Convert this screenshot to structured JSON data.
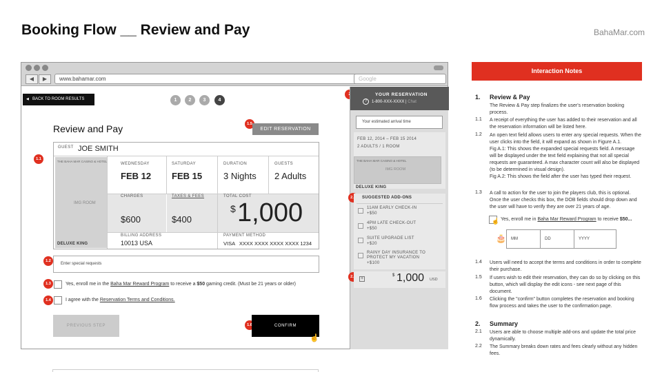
{
  "header": {
    "title": "Booking Flow  __  Review and Pay",
    "brand": "BahaMar.com"
  },
  "browser": {
    "url": "www.bahamar.com",
    "search_placeholder": "Google",
    "nav_back": "◀",
    "nav_forward": "▶"
  },
  "nav": {
    "back_label": "BACK TO ROOM RESULTS",
    "steps": [
      "1",
      "2",
      "3",
      "4"
    ],
    "active_step": 4
  },
  "review": {
    "title": "Review and Pay",
    "edit_label": "EDIT RESERVATION",
    "guest_label": "GUEST",
    "guest_name": "JOE SMITH",
    "hotel_name": "THE BAHA MAR CASINO & HOTEL",
    "img_label": "IMG ROOM",
    "room_type": "DELUXE KING",
    "checkin_label": "WEDNESDAY",
    "checkin_value": "FEB 12",
    "checkout_label": "SATURDAY",
    "checkout_value": "FEB 15",
    "duration_label": "DURATION",
    "duration_value": "3 Nights",
    "guests_label": "GUESTS",
    "guests_value": "2 Adults",
    "charges_label": "CHARGES",
    "charges_value": "$600",
    "taxes_label": "TAXES & FEES",
    "taxes_value": "$400",
    "total_label": "TOTAL COST",
    "total_currency": "$",
    "total_value": "1,000",
    "billing_label": "BILLING ADDRESS",
    "billing_value": "10013 USA",
    "payment_label": "PAYMENT METHOD",
    "payment_value": "VISA   XXXX XXXX XXXX XXXX 1234",
    "special_placeholder": "Enter special requests",
    "enroll_pre": "Yes, enroll me in the ",
    "enroll_link": "Baha Mar Reward Program",
    "enroll_mid": " to receive a ",
    "enroll_amt": "$50",
    "enroll_post": " gaming credit. (Must be 21 years or older)",
    "agree_pre": "I agree with the ",
    "agree_link": "Reservation Terms and Conditions.",
    "prev_label": "PREVIOUS STEP",
    "confirm_label": "CONFIRM"
  },
  "badges": [
    "1.1",
    "1.2",
    "1.3",
    "1.4",
    "1.5",
    "1.6",
    "2",
    "2.1",
    "2.2"
  ],
  "reservation": {
    "title": "YOUR RESERVATION",
    "phone_icon": "?",
    "phone": "1-800-XXX-XXXX",
    "sep": "|",
    "chat": "Chat",
    "arrival_placeholder": "Your estimated arrival time",
    "dates": "FEB 12, 2014 – FEB 15 2014",
    "party": "2 ADULTS / 1 ROOM",
    "hotel_name": "THE BAHA MAR CASINO & HOTEL",
    "img_label": "IMG ROOM",
    "room_type": "DELUXE KING",
    "addons_title": "SUGGESTED ADD-ONS",
    "addons": [
      {
        "name": "11AM EARLY CHECK-IN",
        "price": "+$50"
      },
      {
        "name": "4PM LATE CHECK-OUT",
        "price": "+$50"
      },
      {
        "name": "SUITE UPGRADE LIST",
        "price": "+$20"
      },
      {
        "name": "RAINY DAY INSURANCE TO",
        "name2": "PROTECT MY VACATION",
        "price": "+$100"
      }
    ],
    "plus": "+",
    "total_currency": "$",
    "total_value": "1,000",
    "total_unit": "USD"
  },
  "notes": {
    "bar_title": "Interaction Notes",
    "s1_num": "1.",
    "s1_title": "Review & Pay",
    "s1_intro": "The Review & Pay step finalizes the user's reservation booking process.",
    "n11_num": "1.1",
    "n11": "A receipt of everything the user has added to their reservation and all the reservation information will be listed here.",
    "n12_num": "1.2",
    "n12": "An open text field allows users to enter any special requests. When the user clicks into the field, it will expand as shown in Figure A.1.",
    "fa1": "Fig A.1: This shows the expanded special requests field. A message will be displayed under the text field explaining that not all special requests are guaranteed. A max character count will also be displayed (to be determined in visual design).",
    "fa2": "Fig A.2: This shows the field after the user has typed their request.",
    "n13_num": "1.3",
    "n13": "A call to action for the user to join the players club, this is optional. Once the user checks this box, the DOB fields should drop down and the user will have to verify they are over 21 years of age.",
    "enroll_pre": "Yes, enroll me in ",
    "enroll_link": "Baha Mar Reward Program",
    "enroll_mid": " to receive ",
    "enroll_amt": "$50...",
    "dob_mm": "MM",
    "dob_dd": "DD",
    "dob_yyyy": "YYYY",
    "n14_num": "1.4",
    "n14": "Users will need to accept the terms and conditions in order to complete their purchase.",
    "n15_num": "1.5",
    "n15": "If users wish to edit their reservation, they can do so by clicking on this button, which will display the edit icons - see next page of this document.",
    "n16_num": "1.6",
    "n16": "Clicking the \"confirm\" button completes the reservation and booking flow process and takes the user to the confirmation page.",
    "s2_num": "2.",
    "s2_title": "Summary",
    "n21_num": "2.1",
    "n21": "Users are able to choose multiple add-ons and update the total price dynamically.",
    "n22_num": "2.2",
    "n22": "The Summary breaks down rates and fees clearly without any hidden fees."
  }
}
